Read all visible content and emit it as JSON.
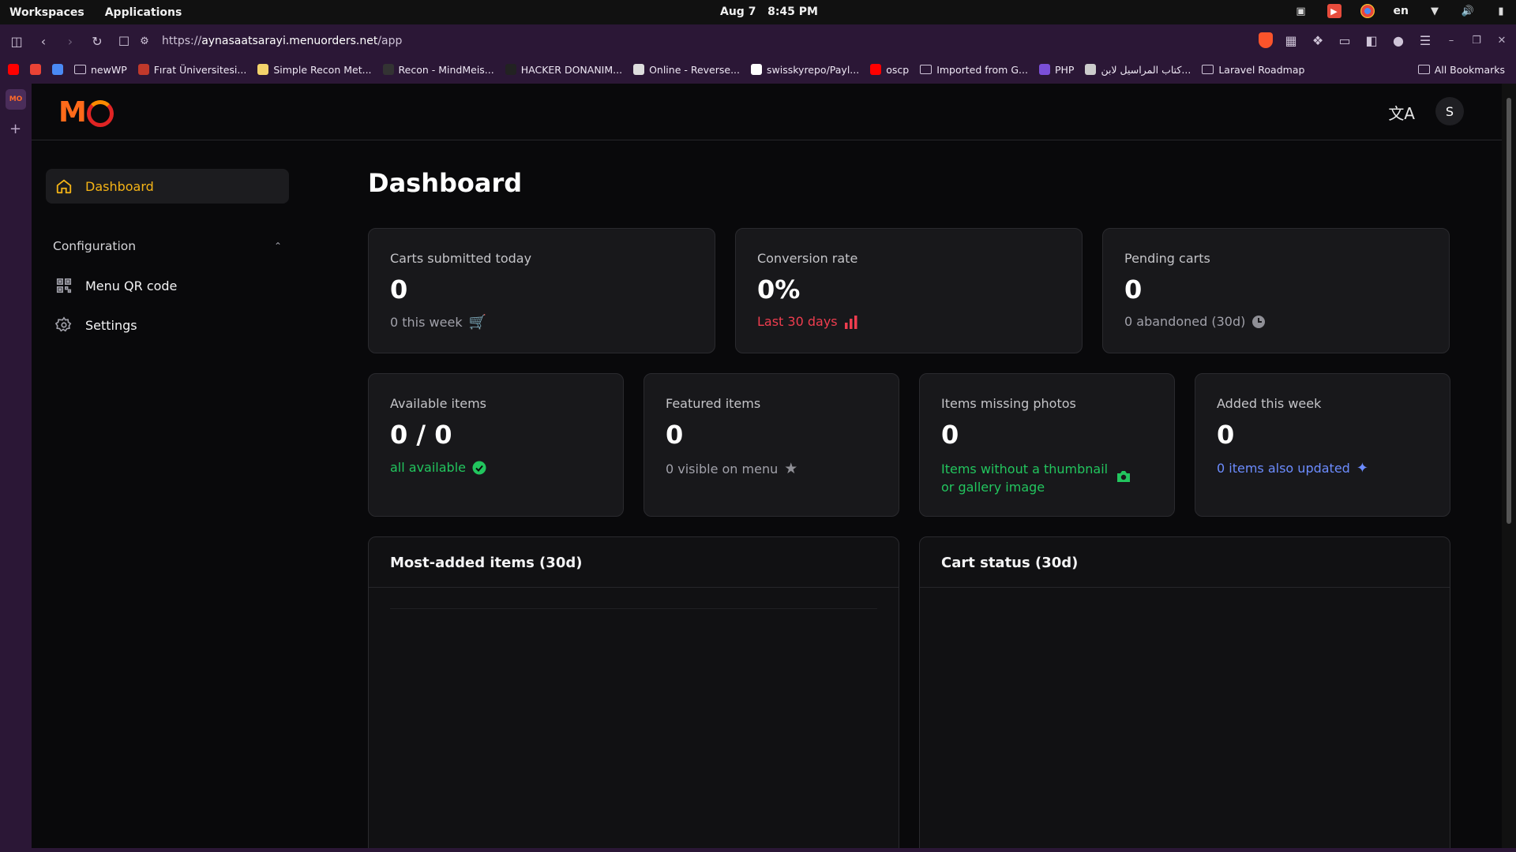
{
  "os": {
    "workspaces": "Workspaces",
    "applications": "Applications",
    "date": "Aug 7",
    "time": "8:45 PM",
    "lang": "en"
  },
  "browser": {
    "url_scheme": "https://",
    "url_host": "aynasaatsarayi.menuorders.net",
    "url_path": "/app",
    "bookmarks": [
      {
        "label": "",
        "icon": "youtube-icon",
        "color": "#ff0000"
      },
      {
        "label": "",
        "icon": "gmail-icon",
        "color": "#ea4335"
      },
      {
        "label": "",
        "icon": "translate-icon",
        "color": "#4a8af4"
      },
      {
        "label": "newWP",
        "icon": "folder-icon"
      },
      {
        "label": "Fırat Üniversitesi...",
        "icon": "university-icon",
        "color": "#c0392b"
      },
      {
        "label": "Simple Recon Met...",
        "icon": "page-icon",
        "color": "#f3d36b"
      },
      {
        "label": "Recon - MindMeis...",
        "icon": "mindmeister-icon",
        "color": "#333333"
      },
      {
        "label": "HACKER DONANIM...",
        "icon": "page-icon",
        "color": "#222222"
      },
      {
        "label": "Online - Reverse...",
        "icon": "skull-icon",
        "color": "#dddddd"
      },
      {
        "label": "swisskyrepo/Payl...",
        "icon": "github-icon",
        "color": "#ffffff"
      },
      {
        "label": "oscp",
        "icon": "youtube-icon",
        "color": "#ff0000"
      },
      {
        "label": "Imported from G...",
        "icon": "folder-icon"
      },
      {
        "label": "PHP",
        "icon": "php-icon",
        "color": "#7a4fd8"
      },
      {
        "label": "كتاب المراسيل لابن...",
        "icon": "globe-icon",
        "color": "#cccccc"
      },
      {
        "label": "Laravel Roadmap",
        "icon": "folder-icon"
      }
    ],
    "all_bookmarks": "All Bookmarks"
  },
  "app": {
    "avatar_initial": "S",
    "colors": {
      "accent": "#f5b416",
      "danger": "#ef3d4f",
      "success": "#22c55e",
      "info": "#6c8cff"
    }
  },
  "sidebar": {
    "active": {
      "label": "Dashboard",
      "icon": "home-icon"
    },
    "section": "Configuration",
    "items": [
      {
        "label": "Menu QR code",
        "icon": "qr-code-icon"
      },
      {
        "label": "Settings",
        "icon": "gear-icon"
      }
    ]
  },
  "main": {
    "title": "Dashboard",
    "stats_top": [
      {
        "label": "Carts submitted today",
        "value": "0",
        "sub": "0 this week",
        "icon": "cart-icon"
      },
      {
        "label": "Conversion rate",
        "value": "0%",
        "sub": "Last 30 days",
        "icon": "bar-chart-icon"
      },
      {
        "label": "Pending carts",
        "value": "0",
        "sub": "0 abandoned (30d)",
        "icon": "clock-icon"
      }
    ],
    "stats_bottom": [
      {
        "label": "Available items",
        "value": "0 / 0",
        "sub": "all available",
        "icon": "check-circle-icon"
      },
      {
        "label": "Featured items",
        "value": "0",
        "sub": "0 visible on menu",
        "icon": "star-icon"
      },
      {
        "label": "Items missing photos",
        "value": "0",
        "sub": "Items without a thumbnail or gallery image",
        "icon": "camera-icon"
      },
      {
        "label": "Added this week",
        "value": "0",
        "sub": "0 items also updated",
        "icon": "sparkles-icon"
      }
    ],
    "panels": [
      {
        "title": "Most-added items (30d)"
      },
      {
        "title": "Cart status (30d)"
      }
    ]
  }
}
